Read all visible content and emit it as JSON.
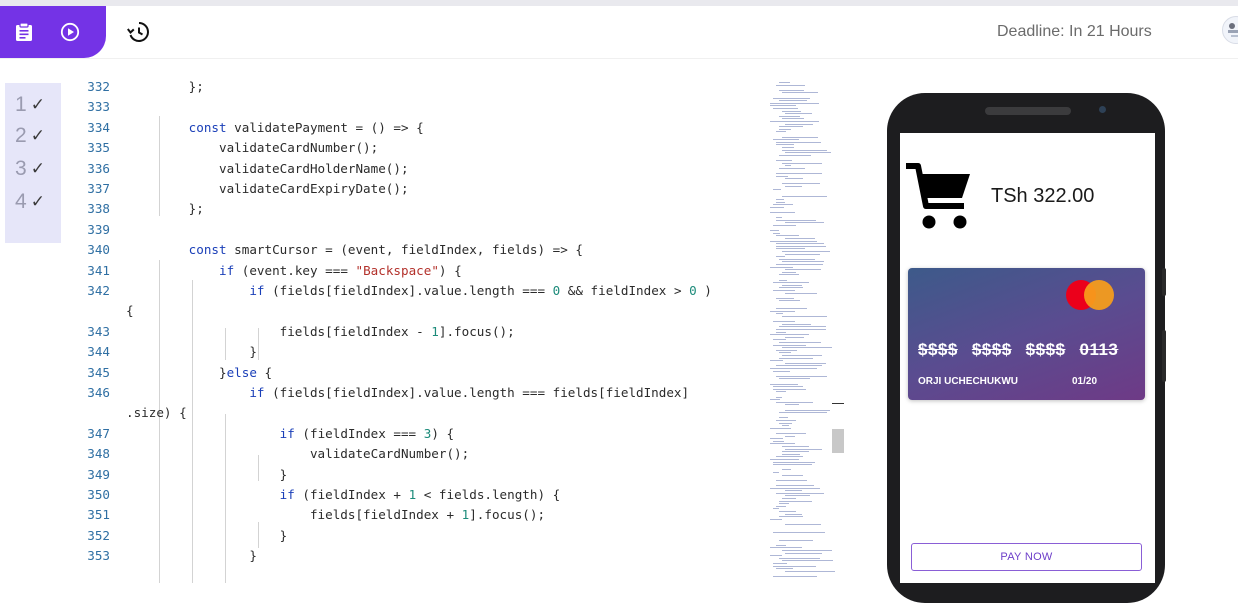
{
  "toolbar": {
    "deadline": "Deadline: In 21 Hours",
    "icons": [
      "clipboard-icon",
      "play-circle-icon",
      "history-icon",
      "avatar"
    ]
  },
  "steps": [
    {
      "label": "1",
      "status": "✓"
    },
    {
      "label": "2",
      "status": "✓"
    },
    {
      "label": "3",
      "status": "✓"
    },
    {
      "label": "4",
      "status": "✓"
    }
  ],
  "editor": {
    "lines": [
      {
        "n": "332",
        "html": "        };"
      },
      {
        "n": "333",
        "html": ""
      },
      {
        "n": "334",
        "html": "        <span class=\"kw\">const</span> validatePayment = () => {"
      },
      {
        "n": "335",
        "html": "            validateCardNumber();"
      },
      {
        "n": "336",
        "html": "            validateCardHolderName();"
      },
      {
        "n": "337",
        "html": "            validateCardExpiryDate();"
      },
      {
        "n": "338",
        "html": "        };"
      },
      {
        "n": "339",
        "html": ""
      },
      {
        "n": "340",
        "html": "        <span class=\"kw\">const</span> smartCursor = (event, fieldIndex, fields) => {"
      },
      {
        "n": "341",
        "html": "            <span class=\"kw\">if</span> (event.key === <span class=\"str\">\"Backspace\"</span>) {"
      },
      {
        "n": "342",
        "html": "                <span class=\"kw\">if</span> (fields[fieldIndex].value.length === <span class=\"num\">0</span> && fieldIndex > <span class=\"num\">0</span> )"
      },
      {
        "n": "",
        "html": "{"
      },
      {
        "n": "343",
        "html": "                    fields[fieldIndex - <span class=\"num\">1</span>].focus();"
      },
      {
        "n": "344",
        "html": "                }"
      },
      {
        "n": "345",
        "html": "            }<span class=\"kw\">else</span> {"
      },
      {
        "n": "346",
        "html": "                <span class=\"kw\">if</span> (fields[fieldIndex].value.length === fields[fieldIndex]"
      },
      {
        "n": "",
        "html": ".size) {"
      },
      {
        "n": "347",
        "html": "                    <span class=\"kw\">if</span> (fieldIndex === <span class=\"num\">3</span>) {"
      },
      {
        "n": "348",
        "html": "                        validateCardNumber();"
      },
      {
        "n": "349",
        "html": "                    }"
      },
      {
        "n": "350",
        "html": "                    <span class=\"kw\">if</span> (fieldIndex + <span class=\"num\">1</span> < fields.length) {"
      },
      {
        "n": "351",
        "html": "                        fields[fieldIndex + <span class=\"num\">1</span>].focus();"
      },
      {
        "n": "352",
        "html": "                    }"
      },
      {
        "n": "353",
        "html": "                }"
      }
    ]
  },
  "preview": {
    "total": "TSh 322.00",
    "card": {
      "groups": [
        "$$$$",
        "$$$$",
        "$$$$",
        "0113"
      ],
      "holder": "ORJI UCHECHUKWU",
      "expiry": "01/20"
    },
    "pay_label": "PAY NOW"
  },
  "colors": {
    "accent": "#7433e6",
    "step_bg": "#e6e6f9",
    "keyword": "#1a3fb8",
    "string": "#b3312b",
    "number": "#1c8b7a"
  }
}
